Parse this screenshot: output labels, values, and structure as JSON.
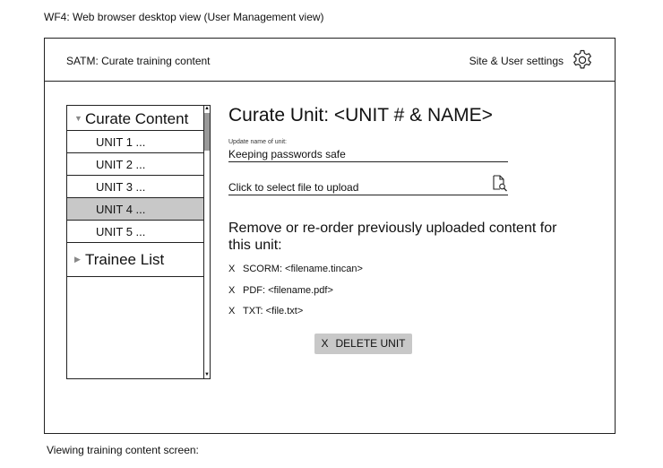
{
  "captions": {
    "top": "WF4: Web browser desktop view (User Management view)",
    "bottom": "Viewing training content screen:"
  },
  "header": {
    "app_title": "SATM: Curate training content",
    "settings_label": "Site & User settings",
    "settings_icon": "gear-icon"
  },
  "sidebar": {
    "curate_section": {
      "label": "Curate Content",
      "expanded": true
    },
    "units": [
      {
        "label": "UNIT 1 ...",
        "selected": false
      },
      {
        "label": "UNIT 2 ...",
        "selected": false
      },
      {
        "label": "UNIT 3 ...",
        "selected": false
      },
      {
        "label": "UNIT 4 ...",
        "selected": true
      },
      {
        "label": "UNIT 5 ...",
        "selected": false
      }
    ],
    "trainee_section": {
      "label": "Trainee List",
      "expanded": false
    }
  },
  "main": {
    "title": "Curate Unit: <UNIT # & NAME>",
    "name_field": {
      "label": "Update name of unit:",
      "value": "Keeping passwords safe"
    },
    "upload": {
      "label": "Click to select file to upload",
      "icon": "file-search-icon"
    },
    "content_heading": "Remove or re-order previously uploaded content for this unit:",
    "content_items": [
      {
        "remove_glyph": "X",
        "label": "SCORM: <filename.tincan>"
      },
      {
        "remove_glyph": "X",
        "label": "PDF: <filename.pdf>"
      },
      {
        "remove_glyph": "X",
        "label": "TXT: <file.txt>"
      }
    ],
    "delete_button": {
      "glyph": "X",
      "label": "DELETE UNIT"
    }
  }
}
